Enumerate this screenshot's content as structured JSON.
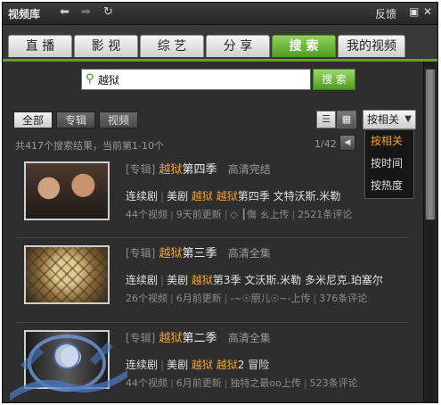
{
  "titlebar": {
    "title": "视频库",
    "back": "⬅",
    "forward": "➡",
    "refresh": "↻",
    "feedback": "反馈",
    "restore": "▣",
    "close": "✕"
  },
  "tabs": [
    {
      "label": "直 播",
      "active": false
    },
    {
      "label": "影 视",
      "active": false
    },
    {
      "label": "综 艺",
      "active": false
    },
    {
      "label": "分 享",
      "active": false
    },
    {
      "label": "搜 索",
      "active": true
    },
    {
      "label": "我的视频",
      "active": false
    }
  ],
  "search": {
    "value": "越狱",
    "button": "搜 索"
  },
  "filters": {
    "all": "全部",
    "album": "专辑",
    "video": "视频"
  },
  "view": {
    "list": "☰",
    "grid": "▦"
  },
  "sort": {
    "current": "按相关",
    "caret": "▼",
    "options": [
      "按相关",
      "按时间",
      "按热度"
    ]
  },
  "result_info": "共417个搜索结果，当前第1-10个",
  "page_info": "1/42",
  "page_prev": "◀",
  "results": [
    {
      "tag": "[专辑]",
      "title_hl": "越狱",
      "title_rest": "第四季",
      "sub": "高清完结",
      "meta_type": "连续剧",
      "meta_region": "美剧",
      "m_hl1": "越狱",
      "m_hl2": "越狱",
      "m_rest": "第四季 文特沃斯.米勒",
      "stat1": "44个视频",
      "stat2": "9天前更新",
      "stat3": "◇ ┃傷 ㄠ上传",
      "stat4": "2521条评论"
    },
    {
      "tag": "[专辑]",
      "title_hl": "越狱",
      "title_rest": "第三季",
      "sub": "高清全集",
      "meta_type": "连续剧",
      "meta_region": "美剧",
      "m_hl1": "越狱",
      "m_hl2": "",
      "m_rest": "第3季 文沃斯.米勒 多米尼克.珀塞尔",
      "stat1": "26个视频",
      "stat2": "6月前更新",
      "stat3": "-~☉朋儿☉~-上传",
      "stat4": "376条评论"
    },
    {
      "tag": "[专辑]",
      "title_hl": "越狱",
      "title_rest": "第二季",
      "sub": "高清全集",
      "meta_type": "连续剧",
      "meta_region": "美剧",
      "m_hl1": "越狱",
      "m_hl2": "越狱",
      "m_rest": "2 冒险",
      "stat1": "44个视频",
      "stat2": "6月前更新",
      "stat3": "独特之最oo上传",
      "stat4": "523条评论"
    }
  ],
  "colors": {
    "accent_green": "#5aa82a",
    "highlight_orange": "#f3a52a",
    "background": "#2e2e2e"
  }
}
